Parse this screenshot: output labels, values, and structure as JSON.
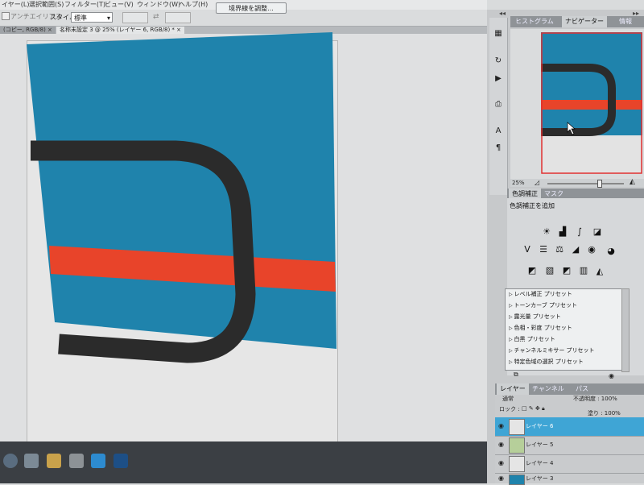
{
  "menu": [
    "イヤー(L)",
    "選択範囲(S)",
    "フィルター(T)",
    "ビュー(V)",
    "ウィンドウ(W)",
    "ヘルプ(H)"
  ],
  "options": {
    "antialias_label": "アンチエイリアス",
    "style_label": "スタイル :",
    "style_value": "標準",
    "refine_edge_button": "境界線を調整..."
  },
  "doc_tabs": [
    "(コピー, RGB/8) ×",
    "名称未設定 3 @ 25% (レイヤー 6, RGB/8) * ×"
  ],
  "panels": {
    "top_tabs": [
      "ヒストグラム",
      "ナビゲーター",
      "情報"
    ],
    "active_top_tab": "ナビゲーター",
    "nav_zoom": "25%",
    "adj_tabs": [
      "色調補正",
      "マスク"
    ],
    "adj_title": "色調補正を追加",
    "presets": [
      "レベル補正 プリセット",
      "トーンカーブ プリセット",
      "露光量 プリセット",
      "色相・彩度 プリセット",
      "白黒 プリセット",
      "チャンネルミキサー プリセット",
      "特定色域の選択 プリセット"
    ],
    "layer_tabs": [
      "レイヤー",
      "チャンネル",
      "パス"
    ],
    "blend_mode": "通常",
    "opacity_label": "不透明度 : 100%",
    "lock_label": "ロック :",
    "fill_label": "塗り : 100%",
    "layers": [
      "レイヤー 6",
      "レイヤー 5",
      "レイヤー 4",
      "レイヤー 3"
    ]
  },
  "colors": {
    "canvas_blue": "#1f83ac",
    "stripe_red": "#e8442a",
    "stroke_dark": "#2b2b2b",
    "selected_layer": "#3fa5d5"
  }
}
